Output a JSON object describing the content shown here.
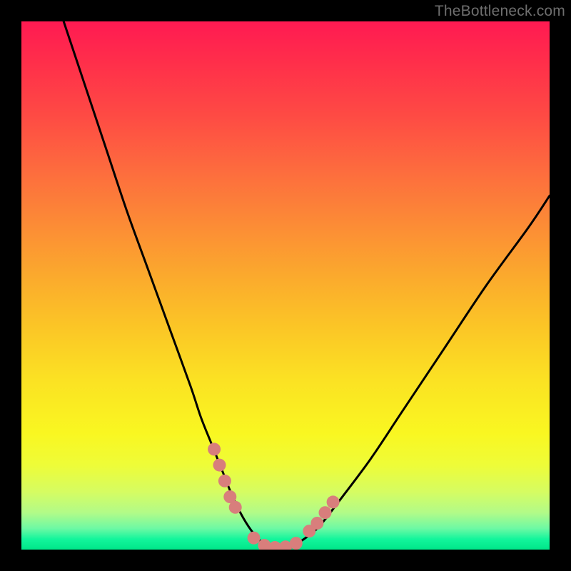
{
  "watermark": "TheBottleneck.com",
  "chart_data": {
    "type": "line",
    "title": "",
    "xlabel": "",
    "ylabel": "",
    "xlim": [
      0,
      100
    ],
    "ylim": [
      0,
      100
    ],
    "series": [
      {
        "name": "bottleneck-curve",
        "x": [
          8,
          12,
          16,
          20,
          24,
          28,
          32,
          34,
          36,
          38,
          40,
          42,
          44,
          46,
          48,
          50,
          52,
          56,
          60,
          66,
          72,
          80,
          88,
          96,
          100
        ],
        "y": [
          100,
          88,
          76,
          64,
          53,
          42,
          31,
          25,
          20,
          15,
          10,
          6,
          3,
          1,
          0,
          0,
          1,
          4,
          9,
          17,
          26,
          38,
          50,
          61,
          67
        ]
      }
    ],
    "markers": [
      {
        "name": "left-cluster",
        "x": [
          36.5,
          37.5,
          38.5,
          39.5,
          40.5
        ],
        "y": [
          19,
          16,
          13,
          10,
          8
        ]
      },
      {
        "name": "valley-cluster",
        "x": [
          44,
          46,
          48,
          50,
          52
        ],
        "y": [
          2.2,
          0.8,
          0.4,
          0.5,
          1.2
        ]
      },
      {
        "name": "right-cluster",
        "x": [
          54.5,
          56,
          57.5,
          59
        ],
        "y": [
          3.5,
          5,
          7,
          9
        ]
      }
    ],
    "gradient_stops": [
      {
        "pos": 0,
        "color": "#ff1a52"
      },
      {
        "pos": 50,
        "color": "#fba92d"
      },
      {
        "pos": 78,
        "color": "#f9f721"
      },
      {
        "pos": 100,
        "color": "#00e789"
      }
    ]
  }
}
